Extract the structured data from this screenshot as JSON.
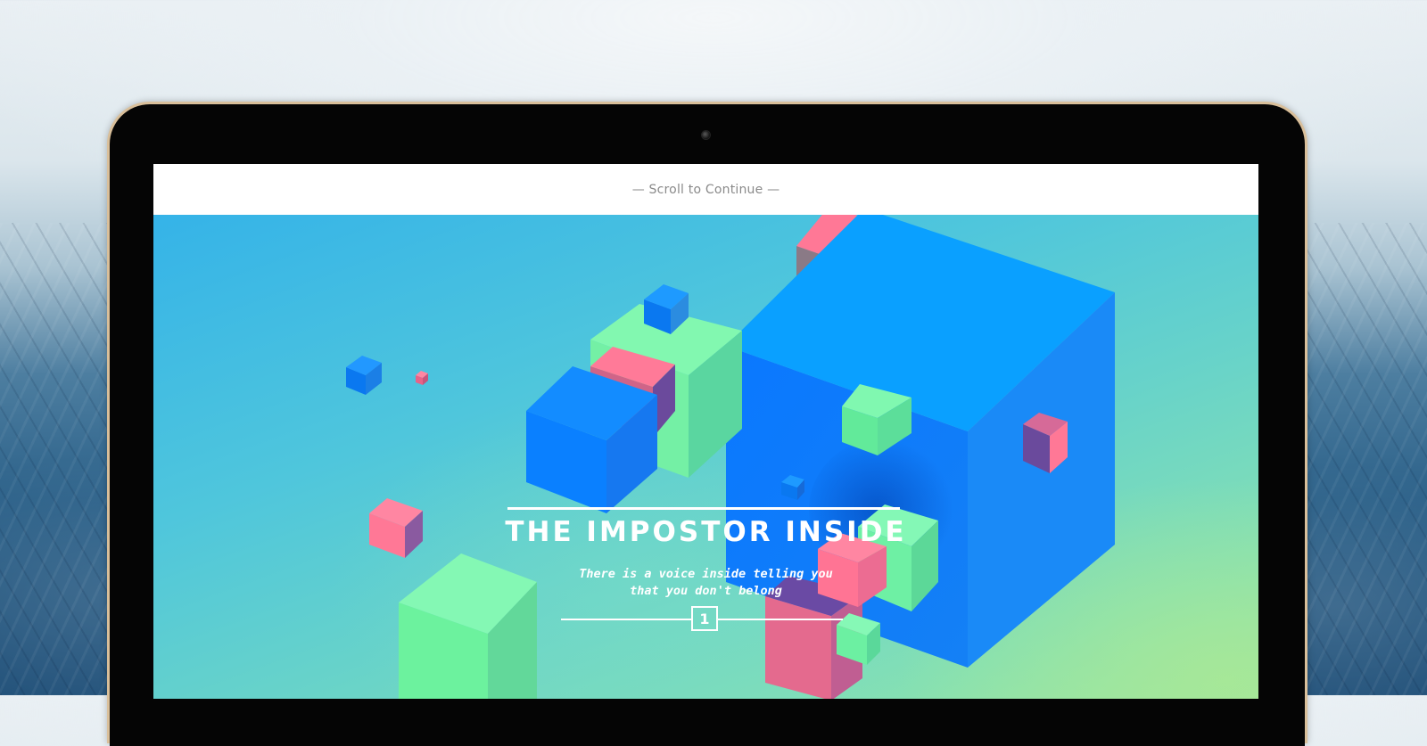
{
  "screen": {
    "scroll_hint": "— Scroll to Continue —"
  },
  "hero": {
    "title": "THE IMPOSTOR INSIDE",
    "subtitle_lines": [
      "There is a voice inside telling you",
      "that you don't belong"
    ],
    "chapter_number": "1"
  },
  "colors": {
    "cube_blue": "#0a84ff",
    "cube_green": "#6ff2a0",
    "cube_pink": "#ff7096",
    "hero_gradient_start": "#35b3e8",
    "hero_gradient_end": "#9fe6a0"
  },
  "icons": {
    "webcam": "webcam-icon"
  }
}
